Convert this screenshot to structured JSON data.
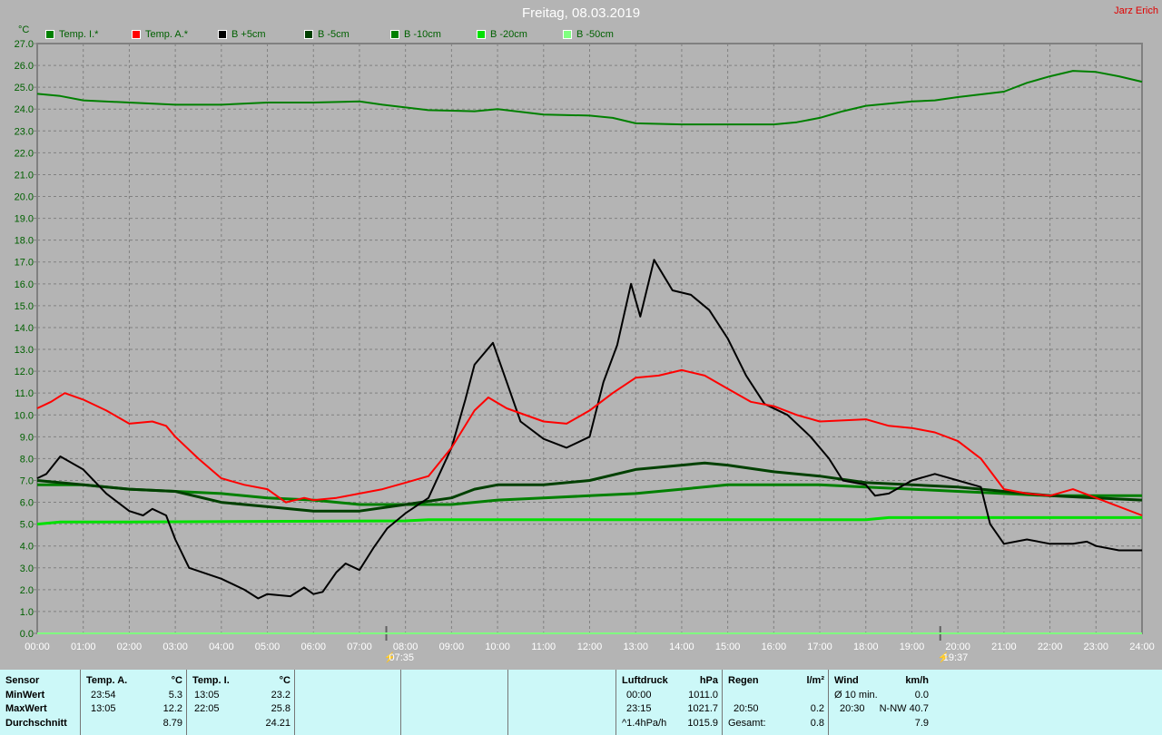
{
  "header": {
    "title": "Freitag, 08.03.2019",
    "author": "Jarz Erich",
    "unit": "°C"
  },
  "chart_data": {
    "type": "line",
    "title": "Freitag, 08.03.2019",
    "xlabel": "",
    "ylabel": "°C",
    "xlim": [
      0,
      24
    ],
    "ylim": [
      0,
      27
    ],
    "grid": true,
    "x_ticks": [
      "00:00",
      "01:00",
      "02:00",
      "03:00",
      "04:00",
      "05:00",
      "06:00",
      "07:00",
      "08:00",
      "09:00",
      "10:00",
      "11:00",
      "12:00",
      "13:00",
      "14:00",
      "15:00",
      "16:00",
      "17:00",
      "18:00",
      "19:00",
      "20:00",
      "21:00",
      "22:00",
      "23:00",
      "24:00"
    ],
    "y_ticks": [
      "0.0",
      "1.0",
      "2.0",
      "3.0",
      "4.0",
      "5.0",
      "6.0",
      "7.0",
      "8.0",
      "9.0",
      "10.0",
      "11.0",
      "12.0",
      "13.0",
      "14.0",
      "15.0",
      "16.0",
      "17.0",
      "18.0",
      "19.0",
      "20.0",
      "21.0",
      "22.0",
      "23.0",
      "24.0",
      "25.0",
      "26.0",
      "27.0"
    ],
    "annotations": {
      "sunrise": "07:35",
      "sunset": "19:37",
      "sunrise_hour": 7.583,
      "sunset_hour": 19.617
    },
    "legend_position": "top",
    "series": [
      {
        "name": "Temp. I.*",
        "color": "#008000",
        "points": [
          [
            0,
            24.7
          ],
          [
            0.5,
            24.6
          ],
          [
            1,
            24.4
          ],
          [
            2,
            24.3
          ],
          [
            3,
            24.2
          ],
          [
            4,
            24.2
          ],
          [
            5,
            24.3
          ],
          [
            6,
            24.3
          ],
          [
            7,
            24.35
          ],
          [
            7.5,
            24.2
          ],
          [
            8.5,
            23.95
          ],
          [
            9.5,
            23.9
          ],
          [
            10,
            24.0
          ],
          [
            11,
            23.75
          ],
          [
            12,
            23.7
          ],
          [
            12.5,
            23.6
          ],
          [
            13,
            23.35
          ],
          [
            14,
            23.3
          ],
          [
            15,
            23.3
          ],
          [
            16,
            23.3
          ],
          [
            16.5,
            23.4
          ],
          [
            17,
            23.6
          ],
          [
            17.5,
            23.9
          ],
          [
            18,
            24.15
          ],
          [
            19,
            24.35
          ],
          [
            19.5,
            24.4
          ],
          [
            20,
            24.55
          ],
          [
            21,
            24.8
          ],
          [
            21.5,
            25.2
          ],
          [
            22,
            25.5
          ],
          [
            22.5,
            25.75
          ],
          [
            23,
            25.7
          ],
          [
            23.5,
            25.5
          ],
          [
            24,
            25.25
          ]
        ]
      },
      {
        "name": "Temp. A.*",
        "color": "#ff0000",
        "points": [
          [
            0,
            10.3
          ],
          [
            0.3,
            10.6
          ],
          [
            0.6,
            11.0
          ],
          [
            1,
            10.7
          ],
          [
            1.5,
            10.2
          ],
          [
            2,
            9.6
          ],
          [
            2.5,
            9.7
          ],
          [
            2.8,
            9.5
          ],
          [
            3,
            9.0
          ],
          [
            3.5,
            8.0
          ],
          [
            4,
            7.1
          ],
          [
            4.5,
            6.8
          ],
          [
            5,
            6.6
          ],
          [
            5.4,
            6.0
          ],
          [
            5.8,
            6.2
          ],
          [
            6,
            6.1
          ],
          [
            6.5,
            6.2
          ],
          [
            7,
            6.4
          ],
          [
            7.5,
            6.6
          ],
          [
            8,
            6.9
          ],
          [
            8.5,
            7.2
          ],
          [
            9,
            8.5
          ],
          [
            9.5,
            10.2
          ],
          [
            9.8,
            10.8
          ],
          [
            10.2,
            10.3
          ],
          [
            11,
            9.7
          ],
          [
            11.5,
            9.6
          ],
          [
            12,
            10.2
          ],
          [
            12.5,
            11.0
          ],
          [
            13,
            11.7
          ],
          [
            13.5,
            11.8
          ],
          [
            14,
            12.05
          ],
          [
            14.5,
            11.8
          ],
          [
            15,
            11.2
          ],
          [
            15.5,
            10.6
          ],
          [
            16,
            10.4
          ],
          [
            16.5,
            10.0
          ],
          [
            17,
            9.7
          ],
          [
            18,
            9.8
          ],
          [
            18.5,
            9.5
          ],
          [
            19,
            9.4
          ],
          [
            19.5,
            9.2
          ],
          [
            20,
            8.8
          ],
          [
            20.5,
            8.0
          ],
          [
            21,
            6.6
          ],
          [
            21.5,
            6.4
          ],
          [
            22,
            6.3
          ],
          [
            22.5,
            6.6
          ],
          [
            23,
            6.2
          ],
          [
            24,
            5.4
          ]
        ]
      },
      {
        "name": "B +5cm",
        "color": "#000000",
        "points": [
          [
            0,
            7.1
          ],
          [
            0.2,
            7.3
          ],
          [
            0.5,
            8.1
          ],
          [
            1,
            7.5
          ],
          [
            1.5,
            6.4
          ],
          [
            2,
            5.6
          ],
          [
            2.3,
            5.4
          ],
          [
            2.5,
            5.7
          ],
          [
            2.8,
            5.4
          ],
          [
            3,
            4.3
          ],
          [
            3.3,
            3.0
          ],
          [
            4,
            2.5
          ],
          [
            4.5,
            2.0
          ],
          [
            4.8,
            1.6
          ],
          [
            5,
            1.8
          ],
          [
            5.5,
            1.7
          ],
          [
            5.8,
            2.1
          ],
          [
            6,
            1.8
          ],
          [
            6.2,
            1.9
          ],
          [
            6.5,
            2.8
          ],
          [
            6.7,
            3.2
          ],
          [
            7,
            2.9
          ],
          [
            7.3,
            3.9
          ],
          [
            7.6,
            4.8
          ],
          [
            8,
            5.5
          ],
          [
            8.5,
            6.2
          ],
          [
            9,
            8.5
          ],
          [
            9.3,
            10.7
          ],
          [
            9.5,
            12.3
          ],
          [
            9.9,
            13.3
          ],
          [
            10.2,
            11.5
          ],
          [
            10.5,
            9.7
          ],
          [
            11,
            8.9
          ],
          [
            11.5,
            8.5
          ],
          [
            12,
            9.0
          ],
          [
            12.3,
            11.5
          ],
          [
            12.6,
            13.2
          ],
          [
            12.9,
            16.0
          ],
          [
            13.1,
            14.5
          ],
          [
            13.4,
            17.1
          ],
          [
            13.8,
            15.7
          ],
          [
            14.2,
            15.5
          ],
          [
            14.6,
            14.8
          ],
          [
            15,
            13.5
          ],
          [
            15.4,
            11.8
          ],
          [
            15.8,
            10.5
          ],
          [
            16.3,
            10.0
          ],
          [
            16.8,
            9.0
          ],
          [
            17.2,
            8.0
          ],
          [
            17.5,
            7.0
          ],
          [
            18,
            6.8
          ],
          [
            18.2,
            6.3
          ],
          [
            18.5,
            6.4
          ],
          [
            19,
            7.0
          ],
          [
            19.5,
            7.3
          ],
          [
            20,
            7.0
          ],
          [
            20.5,
            6.7
          ],
          [
            20.7,
            5.0
          ],
          [
            21,
            4.1
          ],
          [
            21.5,
            4.3
          ],
          [
            22,
            4.1
          ],
          [
            22.5,
            4.1
          ],
          [
            22.8,
            4.2
          ],
          [
            23,
            4.0
          ],
          [
            23.5,
            3.8
          ],
          [
            24,
            3.8
          ]
        ]
      },
      {
        "name": "B -5cm",
        "color": "#004000",
        "points": [
          [
            0,
            7.0
          ],
          [
            1,
            6.8
          ],
          [
            2,
            6.6
          ],
          [
            3,
            6.5
          ],
          [
            4,
            6.0
          ],
          [
            5,
            5.8
          ],
          [
            6,
            5.6
          ],
          [
            7,
            5.6
          ],
          [
            8,
            5.9
          ],
          [
            9,
            6.2
          ],
          [
            9.5,
            6.6
          ],
          [
            10,
            6.8
          ],
          [
            11,
            6.8
          ],
          [
            12,
            7.0
          ],
          [
            13,
            7.5
          ],
          [
            14,
            7.7
          ],
          [
            14.5,
            7.8
          ],
          [
            15,
            7.7
          ],
          [
            16,
            7.4
          ],
          [
            17,
            7.2
          ],
          [
            18,
            6.9
          ],
          [
            19,
            6.8
          ],
          [
            20,
            6.7
          ],
          [
            21,
            6.5
          ],
          [
            22,
            6.3
          ],
          [
            23,
            6.2
          ],
          [
            24,
            6.1
          ]
        ]
      },
      {
        "name": "B -10cm",
        "color": "#008000",
        "points": [
          [
            0,
            6.8
          ],
          [
            1,
            6.8
          ],
          [
            2,
            6.6
          ],
          [
            3,
            6.5
          ],
          [
            4,
            6.4
          ],
          [
            5,
            6.2
          ],
          [
            6,
            6.1
          ],
          [
            7,
            5.9
          ],
          [
            8,
            5.9
          ],
          [
            9,
            5.9
          ],
          [
            10,
            6.1
          ],
          [
            11,
            6.2
          ],
          [
            12,
            6.3
          ],
          [
            13,
            6.4
          ],
          [
            14,
            6.6
          ],
          [
            15,
            6.8
          ],
          [
            16,
            6.8
          ],
          [
            17,
            6.8
          ],
          [
            18,
            6.7
          ],
          [
            19,
            6.6
          ],
          [
            20,
            6.5
          ],
          [
            21,
            6.4
          ],
          [
            22,
            6.3
          ],
          [
            23,
            6.3
          ],
          [
            24,
            6.3
          ]
        ]
      },
      {
        "name": "B -20cm",
        "color": "#00e000",
        "points": [
          [
            0,
            5.0
          ],
          [
            0.5,
            5.1
          ],
          [
            2,
            5.1
          ],
          [
            8,
            5.15
          ],
          [
            8.5,
            5.2
          ],
          [
            12,
            5.2
          ],
          [
            18,
            5.2
          ],
          [
            18.5,
            5.3
          ],
          [
            24,
            5.3
          ]
        ]
      },
      {
        "name": "B -50cm",
        "color": "#80ff80",
        "points": [
          [
            0,
            0.0
          ],
          [
            24,
            0.0
          ]
        ]
      }
    ]
  },
  "stats": {
    "sensor": {
      "h": "Sensor",
      "min": "MinWert",
      "max": "MaxWert",
      "avg": "Durchschnitt"
    },
    "temp_a": {
      "h": "Temp. A.",
      "u": "°C",
      "min_t": "23:54",
      "min_v": "5.3",
      "max_t": "13:05",
      "max_v": "12.2",
      "avg": "8.79"
    },
    "temp_i": {
      "h": "Temp. I.",
      "u": "°C",
      "min_t": "13:05",
      "min_v": "23.2",
      "max_t": "22:05",
      "max_v": "25.8",
      "avg": "24.21"
    },
    "pressure": {
      "h": "Luftdruck",
      "u": "hPa",
      "r1a": "00:00",
      "r1b": "1011.0",
      "r2a": "23:15",
      "r2b": "1021.7",
      "r3a": "^1.4hPa/h",
      "r3b": "1015.9"
    },
    "rain": {
      "h": "Regen",
      "u": "l/m²",
      "r2a": "20:50",
      "r2b": "0.2",
      "r3a": "Gesamt:",
      "r3b": "0.8"
    },
    "wind": {
      "h": "Wind",
      "u": "km/h",
      "r1a": "Ø 10 min.",
      "r1b": "0.0",
      "r2a": "20:30",
      "r2b": "N-NW 40.7",
      "r3b": "7.9"
    }
  }
}
